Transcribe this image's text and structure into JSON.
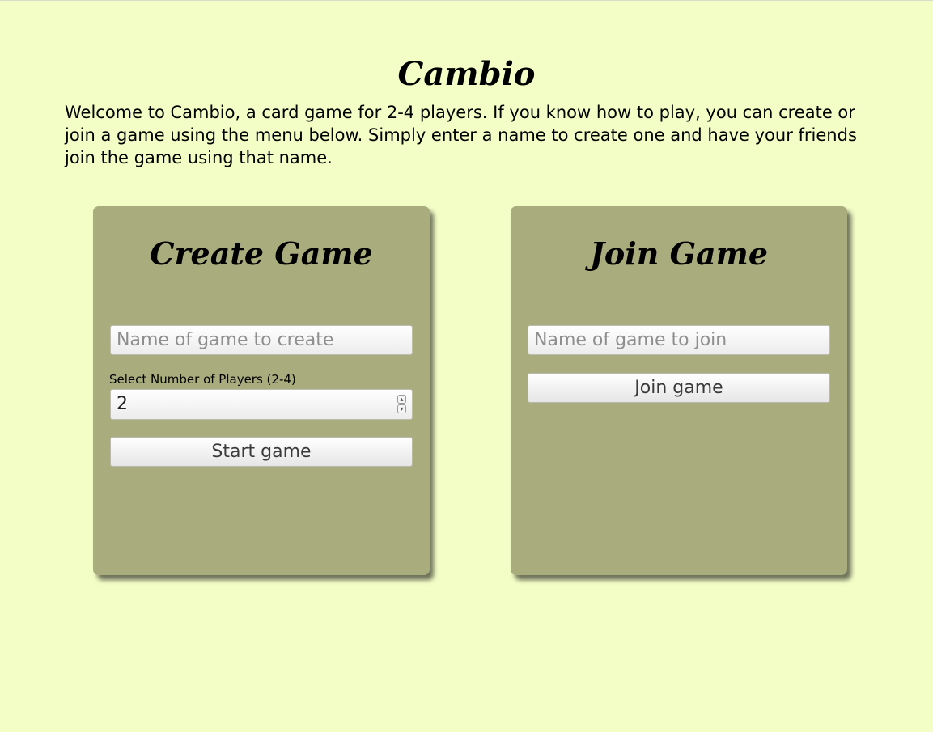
{
  "header": {
    "title": "Cambio",
    "intro": "Welcome to Cambio, a card game for 2-4 players. If you know how to play, you can create or join a game using the menu below. Simply enter a name to create one and have your friends join the game using that name."
  },
  "create_card": {
    "title": "Create Game",
    "name_input": {
      "placeholder": "Name of game to create",
      "value": ""
    },
    "players_label": "Select Number of Players (2-4)",
    "players_value": "2",
    "start_button_label": "Start game"
  },
  "join_card": {
    "title": "Join Game",
    "name_input": {
      "placeholder": "Name of game to join",
      "value": ""
    },
    "join_button_label": "Join game"
  },
  "colors": {
    "page_background": "#f3fdc6",
    "card_background": "#a9ad7e"
  },
  "icons": {
    "stepper_up": "chevron-up-icon",
    "stepper_down": "chevron-down-icon"
  }
}
